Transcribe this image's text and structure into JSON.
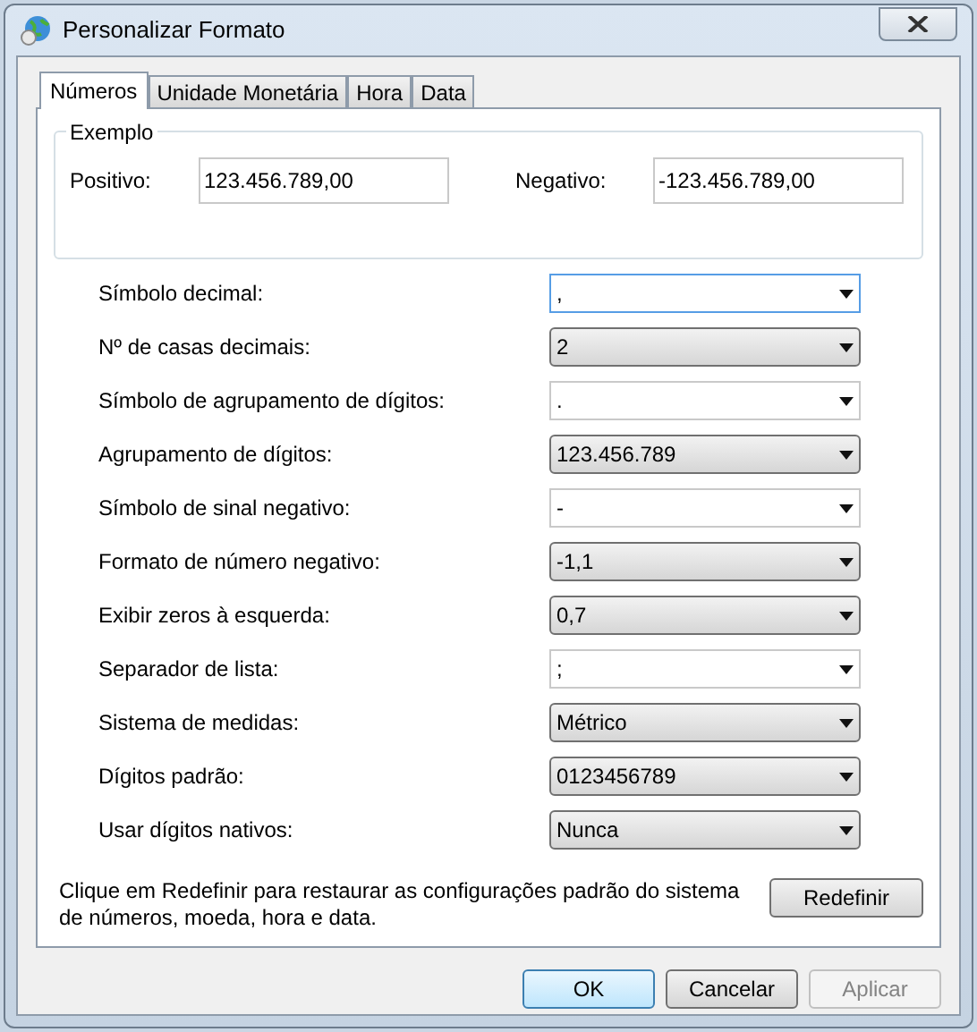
{
  "window": {
    "title": "Personalizar Formato"
  },
  "tabs": [
    {
      "label": "Números",
      "selected": true
    },
    {
      "label": "Unidade Monetária",
      "selected": false
    },
    {
      "label": "Hora",
      "selected": false
    },
    {
      "label": "Data",
      "selected": false
    }
  ],
  "example": {
    "title": "Exemplo",
    "positive_label": "Positivo:",
    "positive_value": "123.456.789,00",
    "negative_label": "Negativo:",
    "negative_value": "-123.456.789,00"
  },
  "settings": [
    {
      "label": "Símbolo decimal:",
      "value": ",",
      "kind": "edit",
      "focused": true
    },
    {
      "label": "Nº de casas decimais:",
      "value": "2",
      "kind": "list",
      "focused": false
    },
    {
      "label": "Símbolo de agrupamento de dígitos:",
      "value": ".",
      "kind": "edit",
      "focused": false
    },
    {
      "label": "Agrupamento de dígitos:",
      "value": "123.456.789",
      "kind": "list",
      "focused": false
    },
    {
      "label": "Símbolo de sinal negativo:",
      "value": "-",
      "kind": "edit",
      "focused": false
    },
    {
      "label": "Formato de número negativo:",
      "value": "-1,1",
      "kind": "list",
      "focused": false
    },
    {
      "label": "Exibir zeros à esquerda:",
      "value": "0,7",
      "kind": "list",
      "focused": false
    },
    {
      "label": "Separador de lista:",
      "value": ";",
      "kind": "edit",
      "focused": false
    },
    {
      "label": "Sistema de medidas:",
      "value": "Métrico",
      "kind": "list",
      "focused": false
    },
    {
      "label": "Dígitos padrão:",
      "value": "0123456789",
      "kind": "list",
      "focused": false
    },
    {
      "label": "Usar dígitos nativos:",
      "value": "Nunca",
      "kind": "list",
      "focused": false
    }
  ],
  "reset": {
    "note": "Clique em Redefinir para restaurar as configurações padrão do sistema de números, moeda, hora e data.",
    "button": "Redefinir"
  },
  "buttons": [
    {
      "label": "OK",
      "default": true,
      "disabled": false
    },
    {
      "label": "Cancelar",
      "default": false,
      "disabled": false
    },
    {
      "label": "Aplicar",
      "default": false,
      "disabled": true
    }
  ]
}
